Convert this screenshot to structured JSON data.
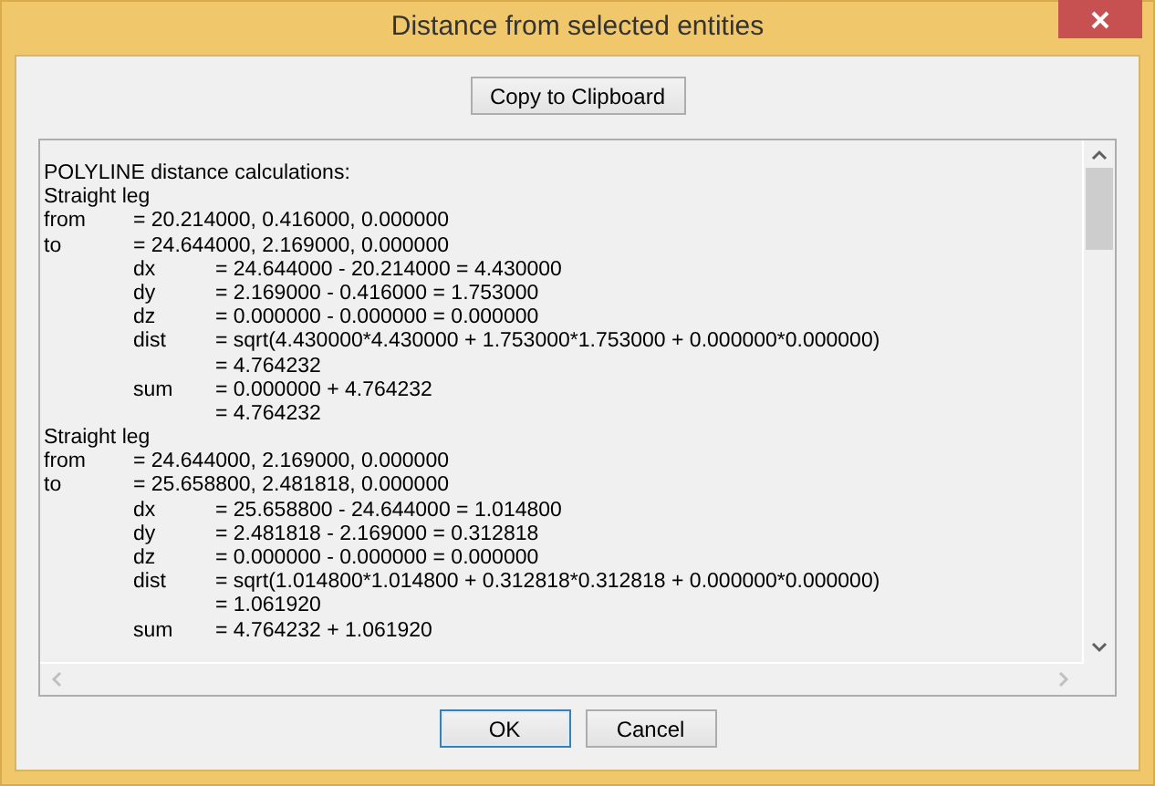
{
  "window": {
    "title": "Distance from selected entities"
  },
  "copy_button": "Copy to Clipboard",
  "output_lines": [
    {
      "kind": "text",
      "text": "POLYLINE distance calculations:"
    },
    {
      "kind": "text",
      "text": "Straight leg"
    },
    {
      "kind": "field",
      "label": "from",
      "value": "= 20.214000, 0.416000, 0.000000"
    },
    {
      "kind": "field",
      "label": "to",
      "value": "= 24.644000, 2.169000, 0.000000"
    },
    {
      "kind": "subfield",
      "label": "dx",
      "value": "= 24.644000 - 20.214000 = 4.430000"
    },
    {
      "kind": "subfield",
      "label": "dy",
      "value": "= 2.169000 - 0.416000 = 1.753000"
    },
    {
      "kind": "subfield",
      "label": "dz",
      "value": "= 0.000000 - 0.000000 = 0.000000"
    },
    {
      "kind": "subfield",
      "label": "dist",
      "value": "= sqrt(4.430000*4.430000 + 1.753000*1.753000 + 0.000000*0.000000)"
    },
    {
      "kind": "continuation",
      "value": "= 4.764232"
    },
    {
      "kind": "subfield",
      "label": "sum",
      "value": "= 0.000000 + 4.764232"
    },
    {
      "kind": "continuation",
      "value": "= 4.764232"
    },
    {
      "kind": "text",
      "text": "Straight leg"
    },
    {
      "kind": "field",
      "label": "from",
      "value": "= 24.644000, 2.169000, 0.000000"
    },
    {
      "kind": "field",
      "label": "to",
      "value": "= 25.658800, 2.481818, 0.000000"
    },
    {
      "kind": "subfield",
      "label": "dx",
      "value": "= 25.658800 - 24.644000 = 1.014800"
    },
    {
      "kind": "subfield",
      "label": "dy",
      "value": "= 2.481818 - 2.169000 = 0.312818"
    },
    {
      "kind": "subfield",
      "label": "dz",
      "value": "= 0.000000 - 0.000000 = 0.000000"
    },
    {
      "kind": "subfield",
      "label": "dist",
      "value": "= sqrt(1.014800*1.014800 + 0.312818*0.312818 + 0.000000*0.000000)"
    },
    {
      "kind": "continuation",
      "value": "= 1.061920"
    },
    {
      "kind": "subfield",
      "label": "sum",
      "value": "= 4.764232 + 1.061920"
    }
  ],
  "buttons": [
    {
      "label": "OK",
      "focused": true
    },
    {
      "label": "Cancel",
      "focused": false
    }
  ]
}
